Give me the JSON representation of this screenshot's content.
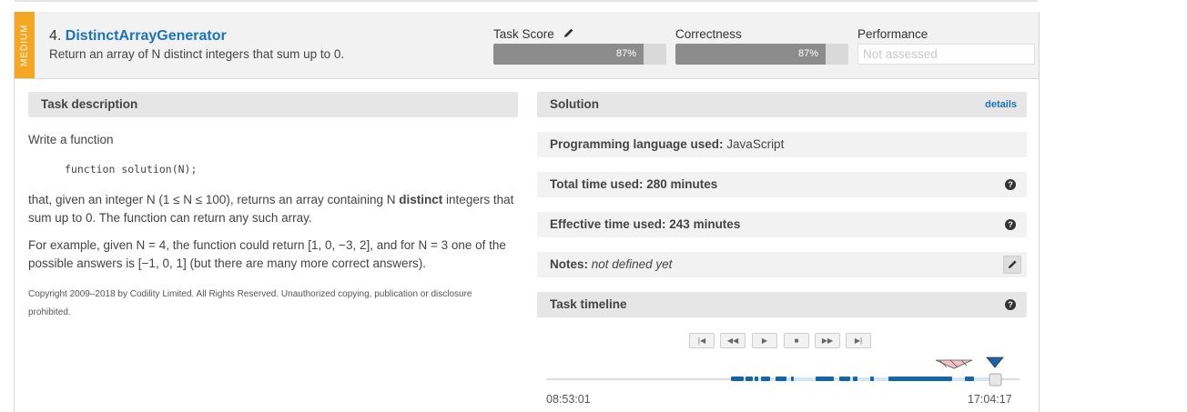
{
  "task": {
    "difficulty": "MEDIUM",
    "number": "4.",
    "name": "DistinctArrayGenerator",
    "summary": "Return an array of N distinct integers that sum up to 0."
  },
  "metrics": {
    "task_score": {
      "label": "Task Score",
      "value": "87%",
      "fraction": 0.87
    },
    "correctness": {
      "label": "Correctness",
      "value": "87%",
      "fraction": 0.87
    },
    "performance": {
      "label": "Performance",
      "value": "Not assessed"
    }
  },
  "description": {
    "heading": "Task description",
    "intro": "Write a function",
    "code": "function solution(N);",
    "p1_a": "that, given an integer N (1 ≤ N ≤ 100), returns an array containing N ",
    "p1_b": "distinct",
    "p1_c": " integers that sum up to 0. The function can return any such array.",
    "p2": "For example, given N = 4, the function could return [1, 0, −3, 2], and for N = 3 one of the possible answers is [−1, 0, 1] (but there are many more correct answers).",
    "copyright": "Copyright 2009–2018 by Codility Limited. All Rights Reserved. Unauthorized copying, publication or disclosure prohibited."
  },
  "solution": {
    "heading": "Solution",
    "details_link": "details",
    "language_label": "Programming language used:",
    "language_value": "JavaScript",
    "total_time": "Total time used: 280 minutes",
    "effective_time": "Effective time used: 243 minutes",
    "notes_label": "Notes:",
    "notes_value": "not defined yet",
    "timeline_heading": "Task timeline"
  },
  "timeline": {
    "controls": [
      "|◀",
      "◀◀",
      "▶",
      "■",
      "▶▶",
      "▶|"
    ],
    "start_time": "08:53:01",
    "end_time": "17:04:17"
  },
  "icons": {
    "edit": "pencil-icon",
    "help": "question-circle-icon"
  },
  "colors": {
    "medium_badge": "#f5a623",
    "link": "#1a73b8",
    "bar_fill": "#8c8c8c",
    "timeline_accent": "#1565a8"
  }
}
